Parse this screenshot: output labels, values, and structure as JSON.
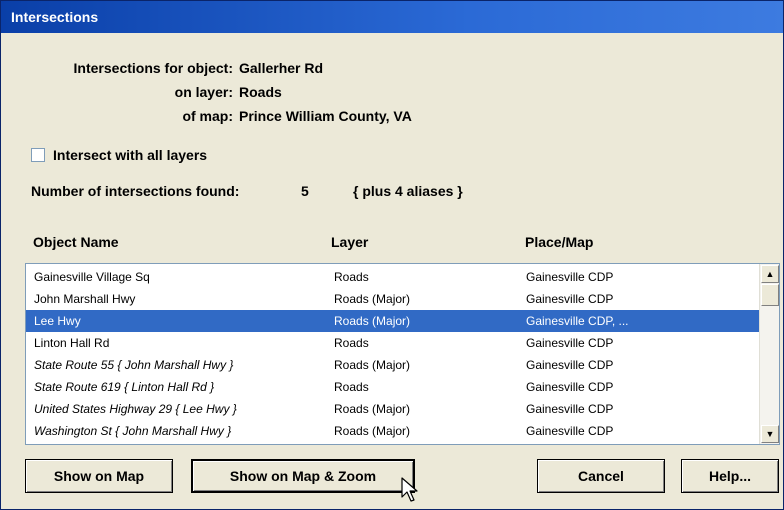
{
  "window": {
    "title": "Intersections"
  },
  "info": {
    "object_label": "Intersections for object:",
    "object_value": "Gallerher Rd",
    "layer_label": "on layer:",
    "layer_value": "Roads",
    "map_label": "of map:",
    "map_value": "Prince William County, VA"
  },
  "options": {
    "intersect_all_label": "Intersect with all layers",
    "intersect_all_checked": false
  },
  "summary": {
    "count_label": "Number of intersections found:",
    "count_value": "5",
    "aliases": "{ plus 4 aliases }"
  },
  "columns": {
    "name": "Object Name",
    "layer": "Layer",
    "place": "Place/Map"
  },
  "rows": [
    {
      "name": "Gainesville Village Sq",
      "layer": "Roads",
      "place": "Gainesville CDP"
    },
    {
      "name": "John Marshall Hwy",
      "layer": "Roads (Major)",
      "place": "Gainesville CDP"
    },
    {
      "name": "Lee Hwy",
      "layer": "Roads (Major)",
      "place": "Gainesville CDP, ..."
    },
    {
      "name": "Linton Hall Rd",
      "layer": "Roads",
      "place": "Gainesville CDP"
    },
    {
      "name": "State Route 55 { John Marshall Hwy }",
      "layer": "Roads (Major)",
      "place": "Gainesville CDP"
    },
    {
      "name": "State Route 619 { Linton Hall Rd }",
      "layer": "Roads",
      "place": "Gainesville CDP"
    },
    {
      "name": "United States Highway 29 { Lee Hwy }",
      "layer": "Roads (Major)",
      "place": "Gainesville CDP"
    },
    {
      "name": "Washington St { John Marshall Hwy }",
      "layer": "Roads (Major)",
      "place": "Gainesville CDP"
    }
  ],
  "selected_row": "Lee Hwy",
  "scrollbar": {
    "up_icon": "arrow-up-icon",
    "down_icon": "arrow-down-icon"
  },
  "buttons": {
    "show_on_map": "Show on Map",
    "show_on_map_zoom": "Show on Map & Zoom",
    "cancel": "Cancel",
    "help": "Help..."
  },
  "colors": {
    "title_bar": "#0a3fa8",
    "selection": "#316ac5",
    "dialog_bg": "#ece9d8"
  }
}
